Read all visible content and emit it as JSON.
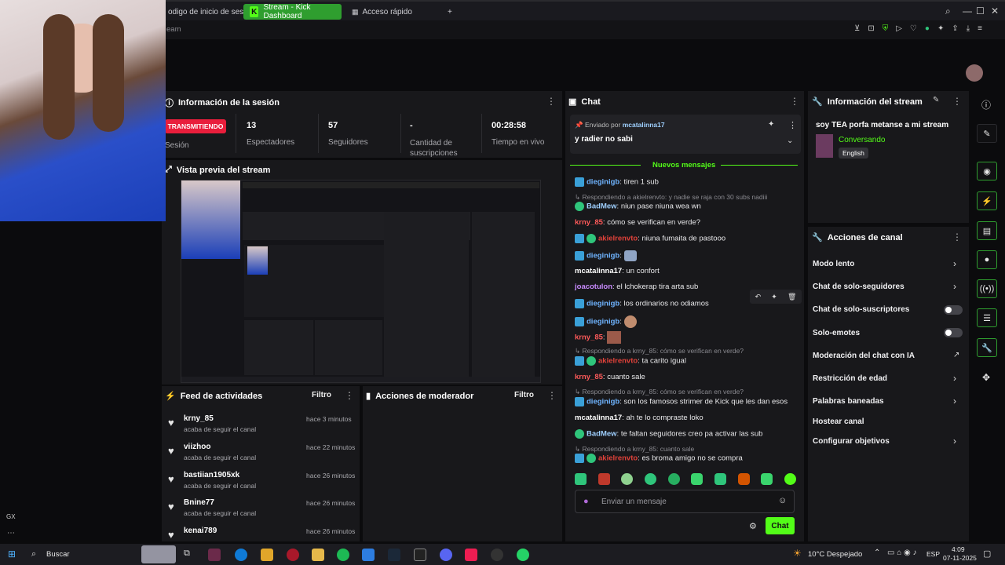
{
  "browser": {
    "tabs": [
      "odigo de inicio de sesi",
      "Stream - Kick Dashboard",
      "Acceso rápido"
    ],
    "new_tab": "+",
    "address_text": "eam"
  },
  "session": {
    "title": "Información de la sesión",
    "status_badge": "TRANSMITIENDO",
    "status_label": "Sesión",
    "stats": [
      {
        "value": "13",
        "label": "Espectadores"
      },
      {
        "value": "57",
        "label": "Seguidores"
      },
      {
        "value": "-",
        "label": "Cantidad de suscripciones"
      },
      {
        "value": "00:28:58",
        "label": "Tiempo en vivo"
      }
    ]
  },
  "preview": {
    "title": "Vista previa del stream"
  },
  "feed": {
    "title": "Feed de actividades",
    "filter": "Filtro",
    "items": [
      {
        "name": "krny_85",
        "time": "hace 3 minutos",
        "sub": "acaba de seguir el canal"
      },
      {
        "name": "viizhoo",
        "time": "hace 22 minutos",
        "sub": "acaba de seguir el canal"
      },
      {
        "name": "bastiian1905xk",
        "time": "hace 26 minutos",
        "sub": "acaba de seguir el canal"
      },
      {
        "name": "Bnine77",
        "time": "hace 26 minutos",
        "sub": "acaba de seguir el canal"
      },
      {
        "name": "kenai789",
        "time": "hace 26 minutos",
        "sub": ""
      }
    ]
  },
  "moderator": {
    "title": "Acciones de moderador",
    "filter": "Filtro"
  },
  "chat": {
    "title": "Chat",
    "pinned_by_label": "Enviado por",
    "pinned_by_user": "mcatalinna17",
    "pinned_text": "y radier no sabi",
    "new_messages": "Nuevos mensajes",
    "messages": [
      {
        "user": "dieginigb",
        "text": ": tiren 1 sub",
        "color": "#6fb4ff",
        "badge": "blue"
      },
      {
        "reply": "Respondiendo a akielrenvto: y nadie se raja con 30 subs nadiii"
      },
      {
        "user": "BadMew",
        "text": ": niun pase niuna wea wn",
        "color": "#9fd0ff",
        "badge": "green"
      },
      {
        "user": "krny_85",
        "text": ": cómo se verifican en verde?",
        "color": "#ff5a5a",
        "badge": ""
      },
      {
        "user": "akielrenvto",
        "text": ": niuna fumaita de pastooo",
        "color": "#e2423a",
        "badge": "both"
      },
      {
        "user": "dieginigb",
        "text": ":",
        "color": "#6fb4ff",
        "badge": "blue"
      },
      {
        "user": "mcatalinna17",
        "text": ": un confort",
        "color": "#ffffff",
        "badge": ""
      },
      {
        "user": "joacotulon",
        "text": ": el lchokerap tira arta sub",
        "color": "#c98bff",
        "badge": ""
      },
      {
        "user": "dieginigb",
        "text": ": los ordinarios no odiamos",
        "color": "#6fb4ff",
        "badge": "blue"
      },
      {
        "user": "dieginigb",
        "text": ":",
        "color": "#6fb4ff",
        "badge": "blue"
      },
      {
        "user": "krny_85",
        "text": ":",
        "color": "#ff5a5a",
        "badge": ""
      },
      {
        "reply": "Respondiendo a krny_85: cómo se verifican en verde?"
      },
      {
        "user": "akielrenvto",
        "text": ": ta carito igual",
        "color": "#e2423a",
        "badge": "both"
      },
      {
        "user": "krny_85",
        "text": ": cuanto sale",
        "color": "#ff5a5a",
        "badge": ""
      },
      {
        "reply": "Respondiendo a krny_85: cómo se verifican en verde?"
      },
      {
        "user": "dieginigb",
        "text": ": son los famosos strimer de Kick que les dan esos",
        "color": "#6fb4ff",
        "badge": "blue"
      },
      {
        "user": "mcatalinna17",
        "text": ": ah te lo compraste loko",
        "color": "#ffffff",
        "badge": ""
      },
      {
        "user": "BadMew",
        "text": ": te faltan seguidores creo pa activar las sub",
        "color": "#9fd0ff",
        "badge": "green"
      },
      {
        "reply": "Respondiendo a krny_85: cuanto sale"
      },
      {
        "user": "akielrenvto",
        "text": ": es broma amigo no se compra",
        "color": "#e2423a",
        "badge": "both"
      }
    ],
    "input_placeholder": "Enviar un mensaje",
    "send_label": "Chat"
  },
  "stream_info": {
    "title": "Información del stream",
    "stream_title": "soy TEA porfa metanse a mi stream",
    "category": "Conversando",
    "language": "English"
  },
  "channel_actions": {
    "title": "Acciones de canal",
    "items": [
      {
        "label": "Modo lento",
        "control": "chevron"
      },
      {
        "label": "Chat de solo-seguidores",
        "control": "chevron"
      },
      {
        "label": "Chat de solo-suscriptores",
        "control": "toggle"
      },
      {
        "label": "Solo-emotes",
        "control": "toggle"
      },
      {
        "label": "Moderación del chat con IA",
        "control": "external"
      },
      {
        "label": "Restricción de edad",
        "control": "chevron"
      },
      {
        "label": "Palabras baneadas",
        "control": "chevron"
      },
      {
        "label": "Hostear canal",
        "control": "none"
      },
      {
        "label": "Configurar objetivos",
        "control": "chevron"
      }
    ]
  },
  "taskbar": {
    "search": "Buscar",
    "weather": "10°C  Despejado",
    "lang": "ESP",
    "time": "4:09",
    "date": "07-11-2025"
  },
  "left_strip": {
    "gx": "GX"
  },
  "colors": {
    "accent": "#53fc18",
    "live": "#e91e3c",
    "panel": "#18181b",
    "bg": "#0b0b0d"
  }
}
